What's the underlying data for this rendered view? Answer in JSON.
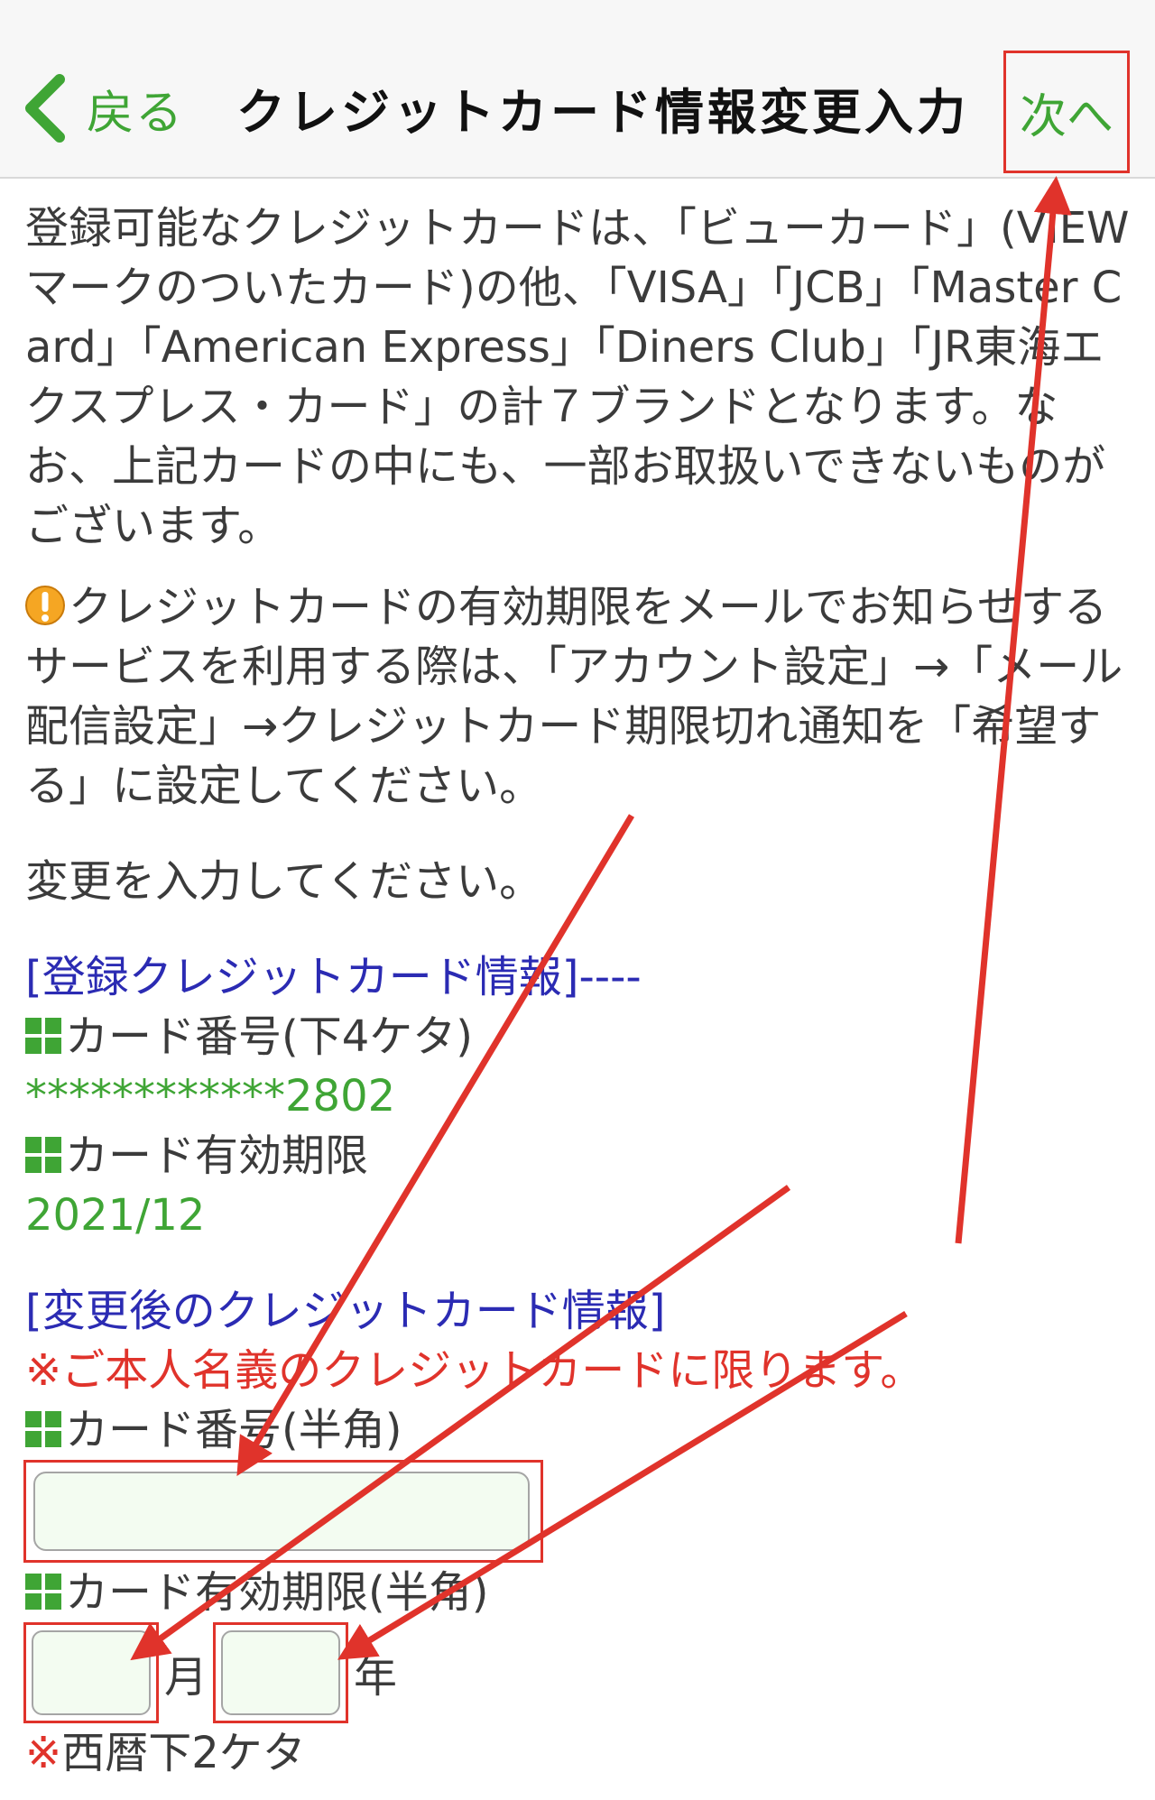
{
  "header": {
    "back_label": "戻る",
    "title": "クレジットカード情報変更入力",
    "next_label": "次へ"
  },
  "intro": {
    "text": "登録可能なクレジットカードは、「ビューカード」(VIEWマークのついたカード)の他、「VISA」「JCB」「Master Card」「American Express」「Diners Club」「JR東海エクスプレス・カード」の計７ブランドとなります。なお、上記カードの中にも、一部お取扱いできないものがございます。"
  },
  "notice": {
    "text": "クレジットカードの有効期限をメールでお知らせするサービスを利用する際は、「アカウント設定」→「メール配信設定」→クレジットカード期限切れ通知を「希望する」に設定してください。"
  },
  "instruction": "変更を入力してください。",
  "registered": {
    "heading": "[登録クレジットカード情報]----",
    "card_number_label": "カード番号(下4ケタ)",
    "card_number_value": "************2802",
    "expiry_label": "カード有効期限",
    "expiry_value": "2021/12"
  },
  "new_card": {
    "heading": "[変更後のクレジットカード情報]",
    "notice": "※ご本人名義のクレジットカードに限ります。",
    "card_number_label": "カード番号(半角)",
    "card_number_value": "",
    "expiry_label": "カード有効期限(半角)",
    "month_value": "",
    "month_unit": "月",
    "year_value": "",
    "year_unit": "年",
    "year_hint_mark": "※",
    "year_hint": "西暦下2ケタ"
  },
  "colors": {
    "accent_green": "#3fa535",
    "link_blue": "#2b2bb3",
    "alert_red": "#e0332b",
    "input_bg": "#f3fcf1"
  },
  "icons": {
    "back": "chevron-left-icon",
    "warning": "warning-icon",
    "bullet": "green-square-icon",
    "annotation": "red-arrow"
  }
}
